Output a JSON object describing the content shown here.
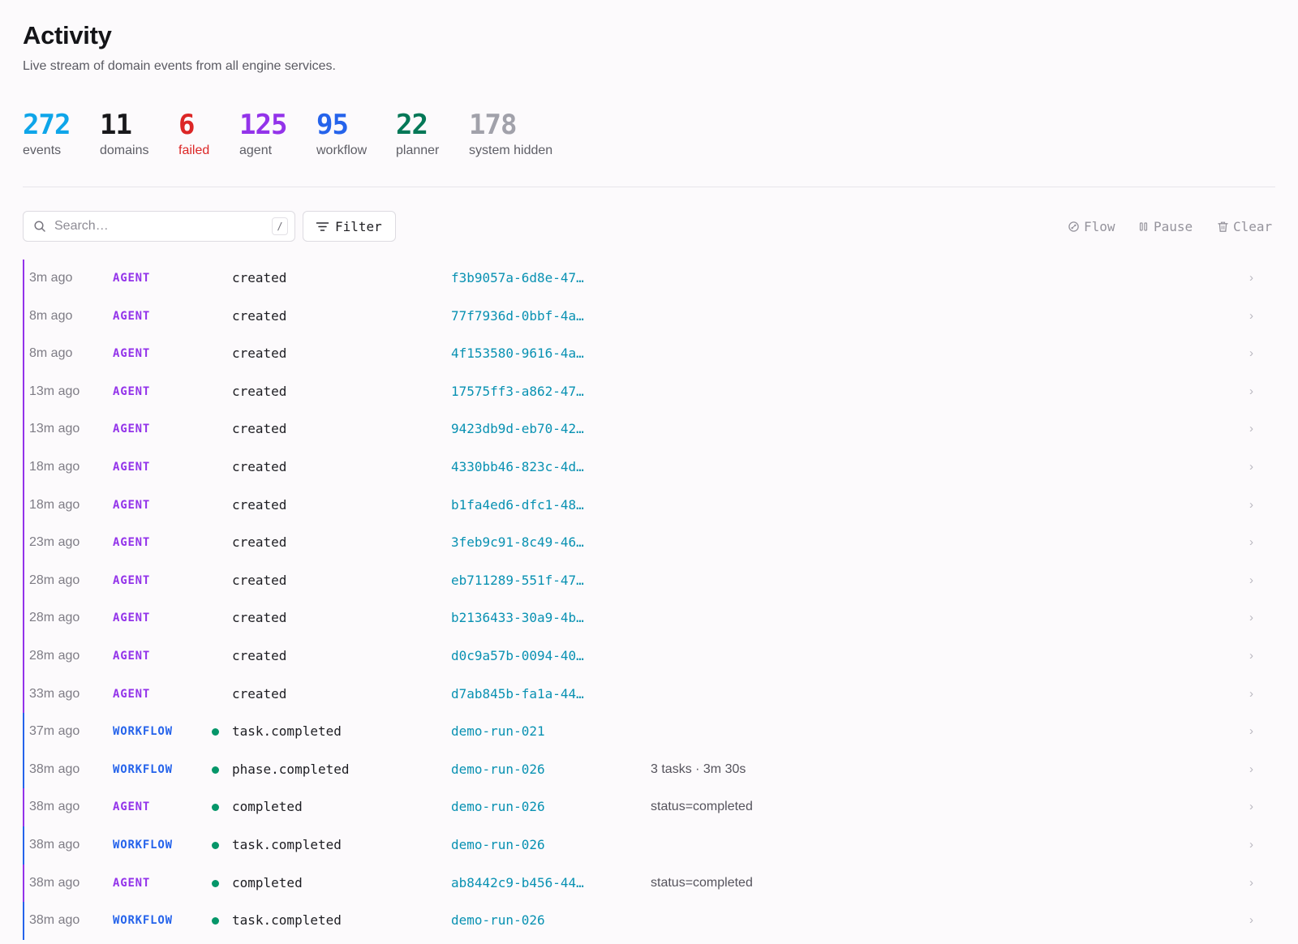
{
  "header": {
    "title": "Activity",
    "subtitle": "Live stream of domain events from all engine services."
  },
  "stats": [
    {
      "value": "272",
      "label": "events",
      "color": "#0ea5e9"
    },
    {
      "value": "11",
      "label": "domains",
      "color": "#18181b"
    },
    {
      "value": "6",
      "label": "failed",
      "color": "#dc2626"
    },
    {
      "value": "125",
      "label": "agent",
      "color": "#9333ea"
    },
    {
      "value": "95",
      "label": "workflow",
      "color": "#2563eb"
    },
    {
      "value": "22",
      "label": "planner",
      "color": "#047857"
    },
    {
      "value": "178",
      "label": "system hidden",
      "color": "#a1a1aa"
    }
  ],
  "toolbar": {
    "search_placeholder": "Search…",
    "search_shortcut": "/",
    "filter_label": "Filter",
    "flow_label": "Flow",
    "pause_label": "Pause",
    "clear_label": "Clear"
  },
  "domain_colors": {
    "AGENT": "#9333ea",
    "WORKFLOW": "#2563eb",
    "success_dot": "#059669",
    "ref_link": "#0891b2"
  },
  "events": [
    {
      "time": "3m ago",
      "domain": "AGENT",
      "event": "created",
      "ref": "f3b9057a-6d8e-47…",
      "detail": "",
      "status_dot": false
    },
    {
      "time": "8m ago",
      "domain": "AGENT",
      "event": "created",
      "ref": "77f7936d-0bbf-4a…",
      "detail": "",
      "status_dot": false
    },
    {
      "time": "8m ago",
      "domain": "AGENT",
      "event": "created",
      "ref": "4f153580-9616-4a…",
      "detail": "",
      "status_dot": false
    },
    {
      "time": "13m ago",
      "domain": "AGENT",
      "event": "created",
      "ref": "17575ff3-a862-47…",
      "detail": "",
      "status_dot": false
    },
    {
      "time": "13m ago",
      "domain": "AGENT",
      "event": "created",
      "ref": "9423db9d-eb70-42…",
      "detail": "",
      "status_dot": false
    },
    {
      "time": "18m ago",
      "domain": "AGENT",
      "event": "created",
      "ref": "4330bb46-823c-4d…",
      "detail": "",
      "status_dot": false
    },
    {
      "time": "18m ago",
      "domain": "AGENT",
      "event": "created",
      "ref": "b1fa4ed6-dfc1-48…",
      "detail": "",
      "status_dot": false
    },
    {
      "time": "23m ago",
      "domain": "AGENT",
      "event": "created",
      "ref": "3feb9c91-8c49-46…",
      "detail": "",
      "status_dot": false
    },
    {
      "time": "28m ago",
      "domain": "AGENT",
      "event": "created",
      "ref": "eb711289-551f-47…",
      "detail": "",
      "status_dot": false
    },
    {
      "time": "28m ago",
      "domain": "AGENT",
      "event": "created",
      "ref": "b2136433-30a9-4b…",
      "detail": "",
      "status_dot": false
    },
    {
      "time": "28m ago",
      "domain": "AGENT",
      "event": "created",
      "ref": "d0c9a57b-0094-40…",
      "detail": "",
      "status_dot": false
    },
    {
      "time": "33m ago",
      "domain": "AGENT",
      "event": "created",
      "ref": "d7ab845b-fa1a-44…",
      "detail": "",
      "status_dot": false
    },
    {
      "time": "37m ago",
      "domain": "WORKFLOW",
      "event": "task.completed",
      "ref": "demo-run-021",
      "detail": "",
      "status_dot": true
    },
    {
      "time": "38m ago",
      "domain": "WORKFLOW",
      "event": "phase.completed",
      "ref": "demo-run-026",
      "detail": "3 tasks · 3m 30s",
      "status_dot": true
    },
    {
      "time": "38m ago",
      "domain": "AGENT",
      "event": "completed",
      "ref": "demo-run-026",
      "detail": "status=completed",
      "status_dot": true
    },
    {
      "time": "38m ago",
      "domain": "WORKFLOW",
      "event": "task.completed",
      "ref": "demo-run-026",
      "detail": "",
      "status_dot": true
    },
    {
      "time": "38m ago",
      "domain": "AGENT",
      "event": "completed",
      "ref": "ab8442c9-b456-44…",
      "detail": "status=completed",
      "status_dot": true
    },
    {
      "time": "38m ago",
      "domain": "WORKFLOW",
      "event": "task.completed",
      "ref": "demo-run-026",
      "detail": "",
      "status_dot": true
    }
  ]
}
